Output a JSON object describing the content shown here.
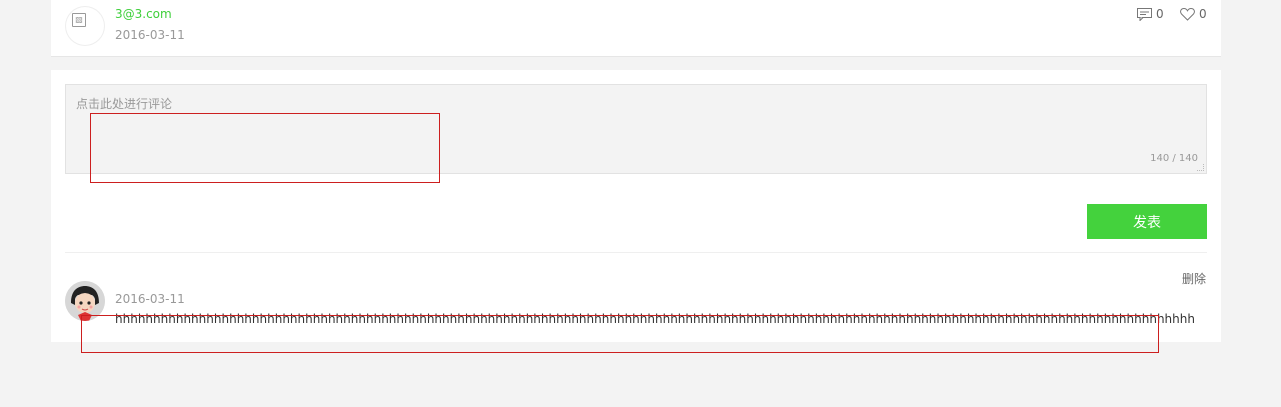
{
  "post": {
    "author": "3@3.com",
    "date": "2016-03-11",
    "comment_count": "0",
    "like_count": "0",
    "comment_icon": "comment-icon",
    "like_icon": "heart-icon"
  },
  "comment_form": {
    "placeholder": "点击此处进行评论",
    "counter": "140 / 140",
    "submit_label": "发表"
  },
  "comments": [
    {
      "date": "2016-03-11",
      "text": "hhhhhhhhhhhhhhhhhhhhhhhhhhhhhhhhhhhhhhhhhhhhhhhhhhhhhhhhhhhhhhhhhhhhhhhhhhhhhhhhhhhhhhhhhhhhhhhhhhhhhhhhhhhhhhhhhhhhhhhhhhhhhhhhhhhhhhhhhhhhhhhhhhhhhhhhhhhhhhhhhh",
      "delete_label": "删除"
    }
  ],
  "colors": {
    "accent": "#44d23d",
    "author": "#3ecf3a",
    "highlight_box": "#cc1f1f",
    "page_bg": "#f3f3f3"
  }
}
